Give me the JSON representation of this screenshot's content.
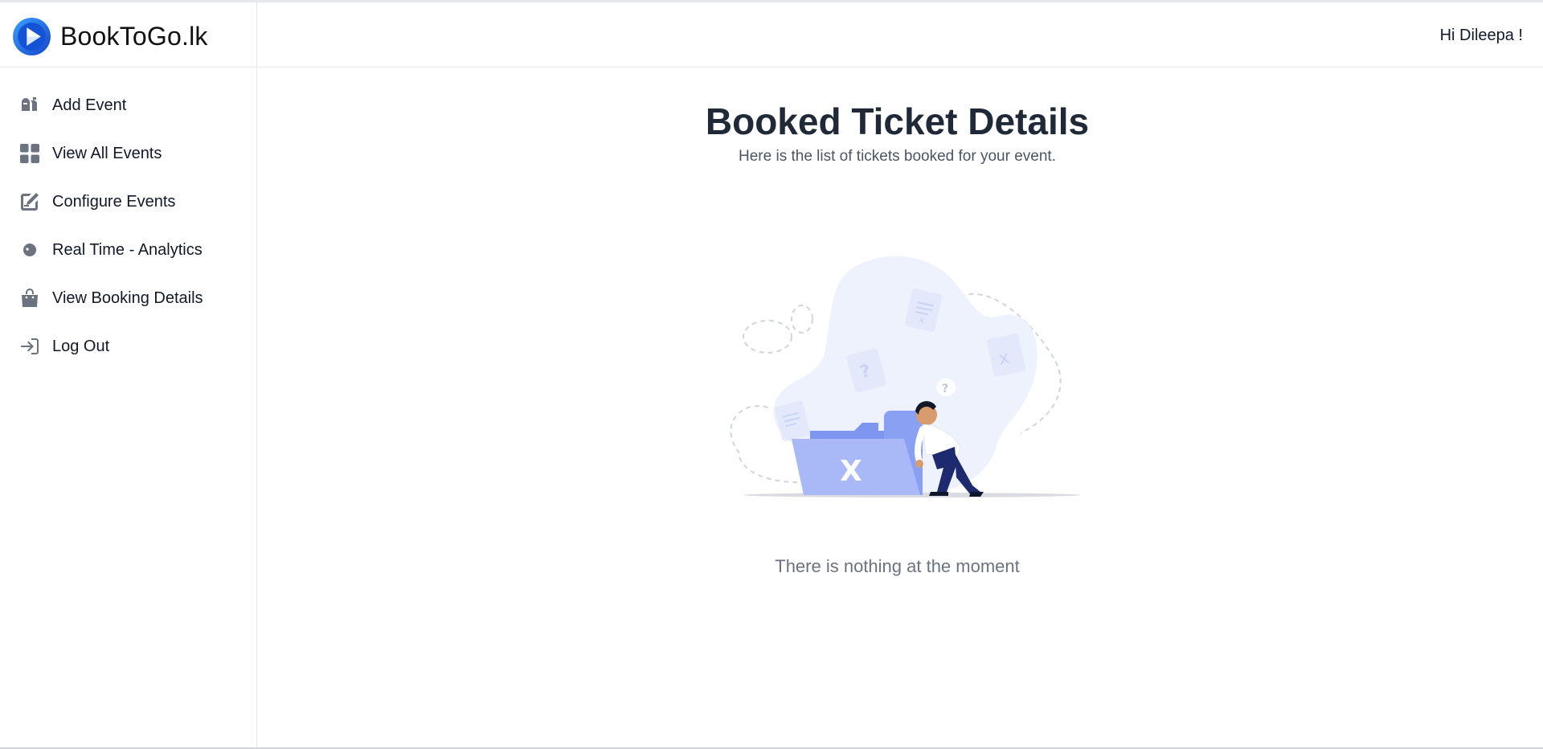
{
  "app": {
    "brand": "BookToGo.lk",
    "accent": "#1d6fe0"
  },
  "header": {
    "greeting": "Hi Dileepa !"
  },
  "sidebar": {
    "items": [
      {
        "label": "Add Event",
        "icon": "mailbox-icon"
      },
      {
        "label": "View All Events",
        "icon": "grid-icon"
      },
      {
        "label": "Configure Events",
        "icon": "edit-icon"
      },
      {
        "label": "Real Time - Analytics",
        "icon": "analytics-icon"
      },
      {
        "label": "View Booking Details",
        "icon": "shopping-bag-icon"
      },
      {
        "label": "Log Out",
        "icon": "logout-icon"
      }
    ]
  },
  "main": {
    "title": "Booked Ticket Details",
    "subtitle": "Here is the list of tickets booked for your event.",
    "empty_message": "There is nothing at the moment",
    "illustration": "empty-folder-illustration"
  }
}
